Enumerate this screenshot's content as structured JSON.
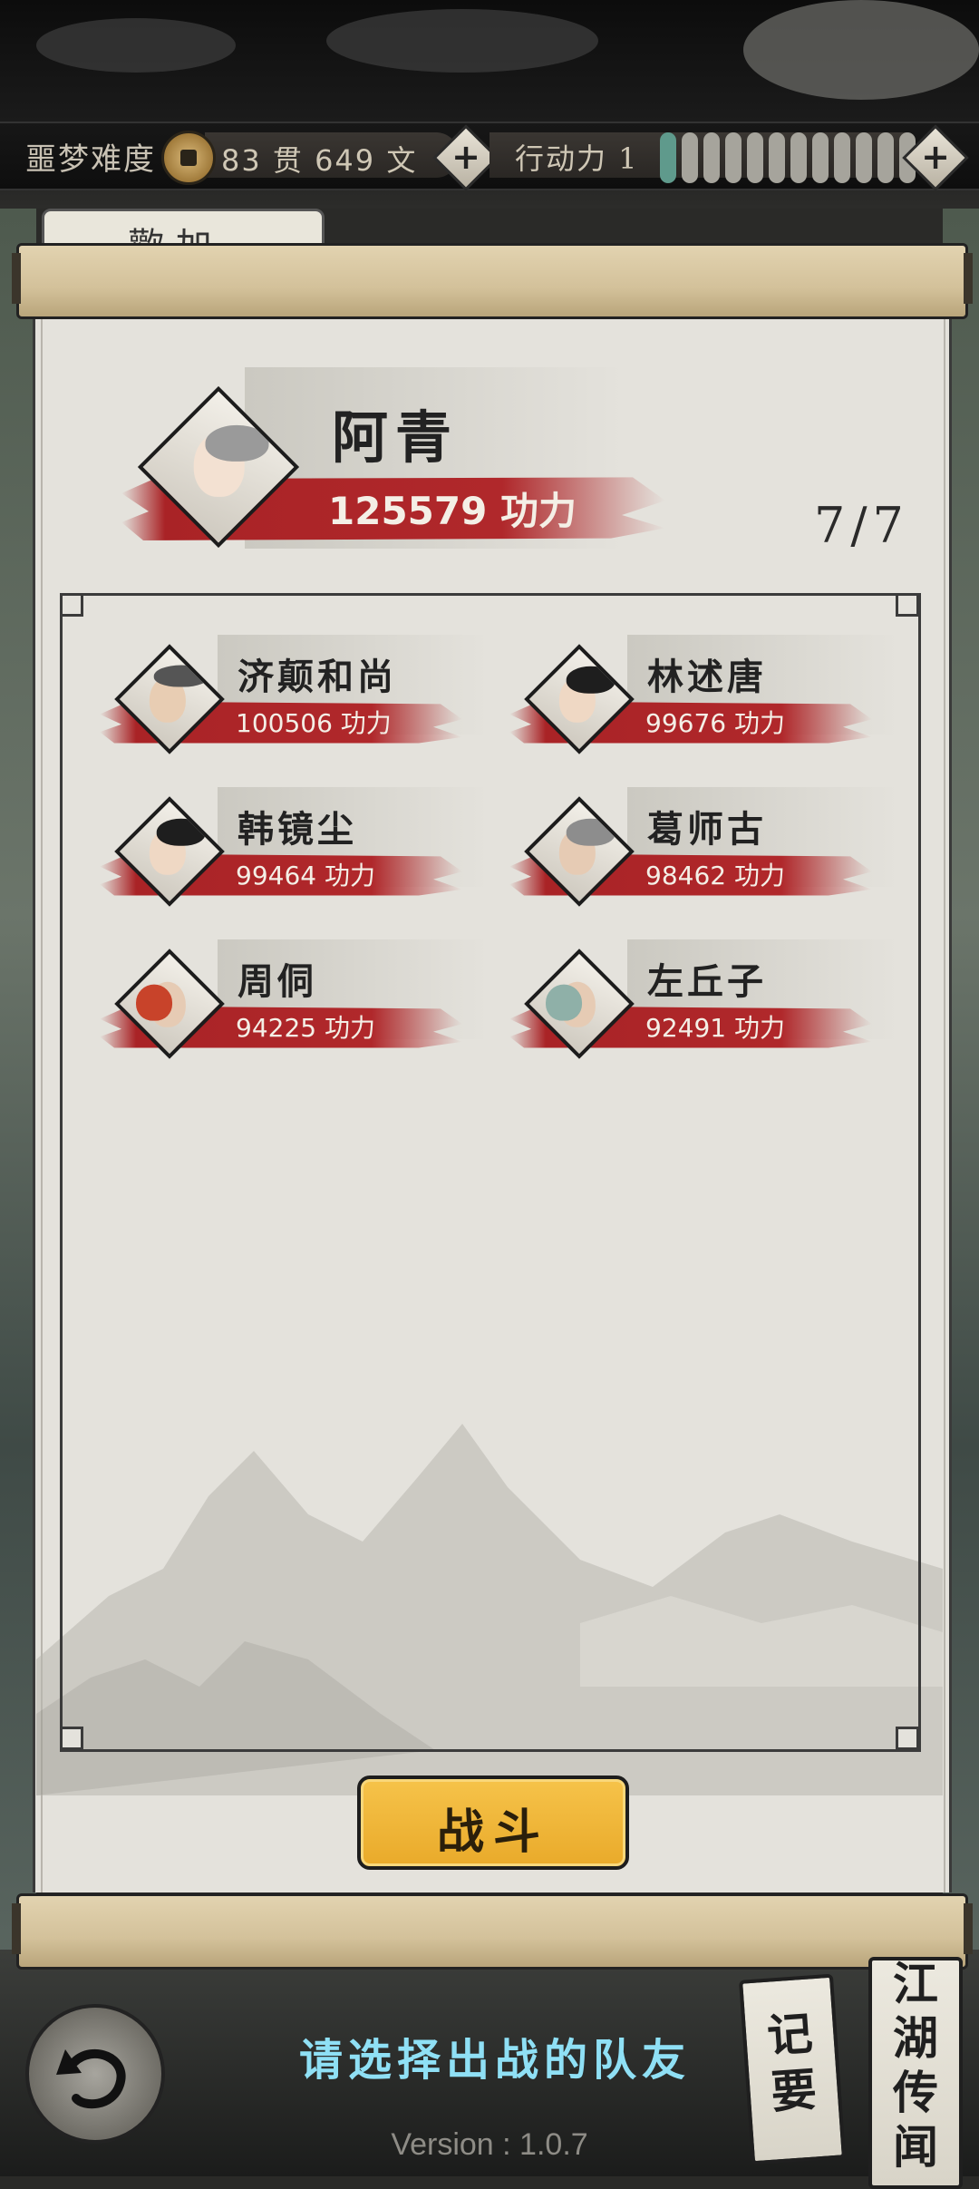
{
  "status_bar": {
    "difficulty": "噩梦难度",
    "money": "83 贯 649 文",
    "action_label": "行动力 1",
    "action_segments_filled": 1,
    "action_segments_total": 12,
    "add_money_label": "+",
    "add_action_label": "+"
  },
  "tab_behind": "歡 加",
  "leader": {
    "name": "阿青",
    "power_value": "125579",
    "power_unit": "功力"
  },
  "team_count": "7/7",
  "members": [
    {
      "name": "济颠和尚",
      "power": "100506 功力"
    },
    {
      "name": "林述唐",
      "power": "99676 功力"
    },
    {
      "name": "韩镜尘",
      "power": "99464 功力"
    },
    {
      "name": "葛师古",
      "power": "98462 功力"
    },
    {
      "name": "周侗",
      "power": "94225 功力"
    },
    {
      "name": "左丘子",
      "power": "92491 功力"
    }
  ],
  "fight_button": "战斗",
  "prompt": "请选择出战的队友",
  "side_buttons": {
    "notes": [
      "记",
      "要"
    ],
    "rumors": [
      "江",
      "湖",
      "传",
      "闻"
    ]
  },
  "version": "Version : 1.0.7",
  "colors": {
    "accent_red": "#a92326",
    "fight_yellow": "#f2b93b",
    "prompt_cyan": "#8fe0f5",
    "action_fill": "#5f9a8c"
  }
}
